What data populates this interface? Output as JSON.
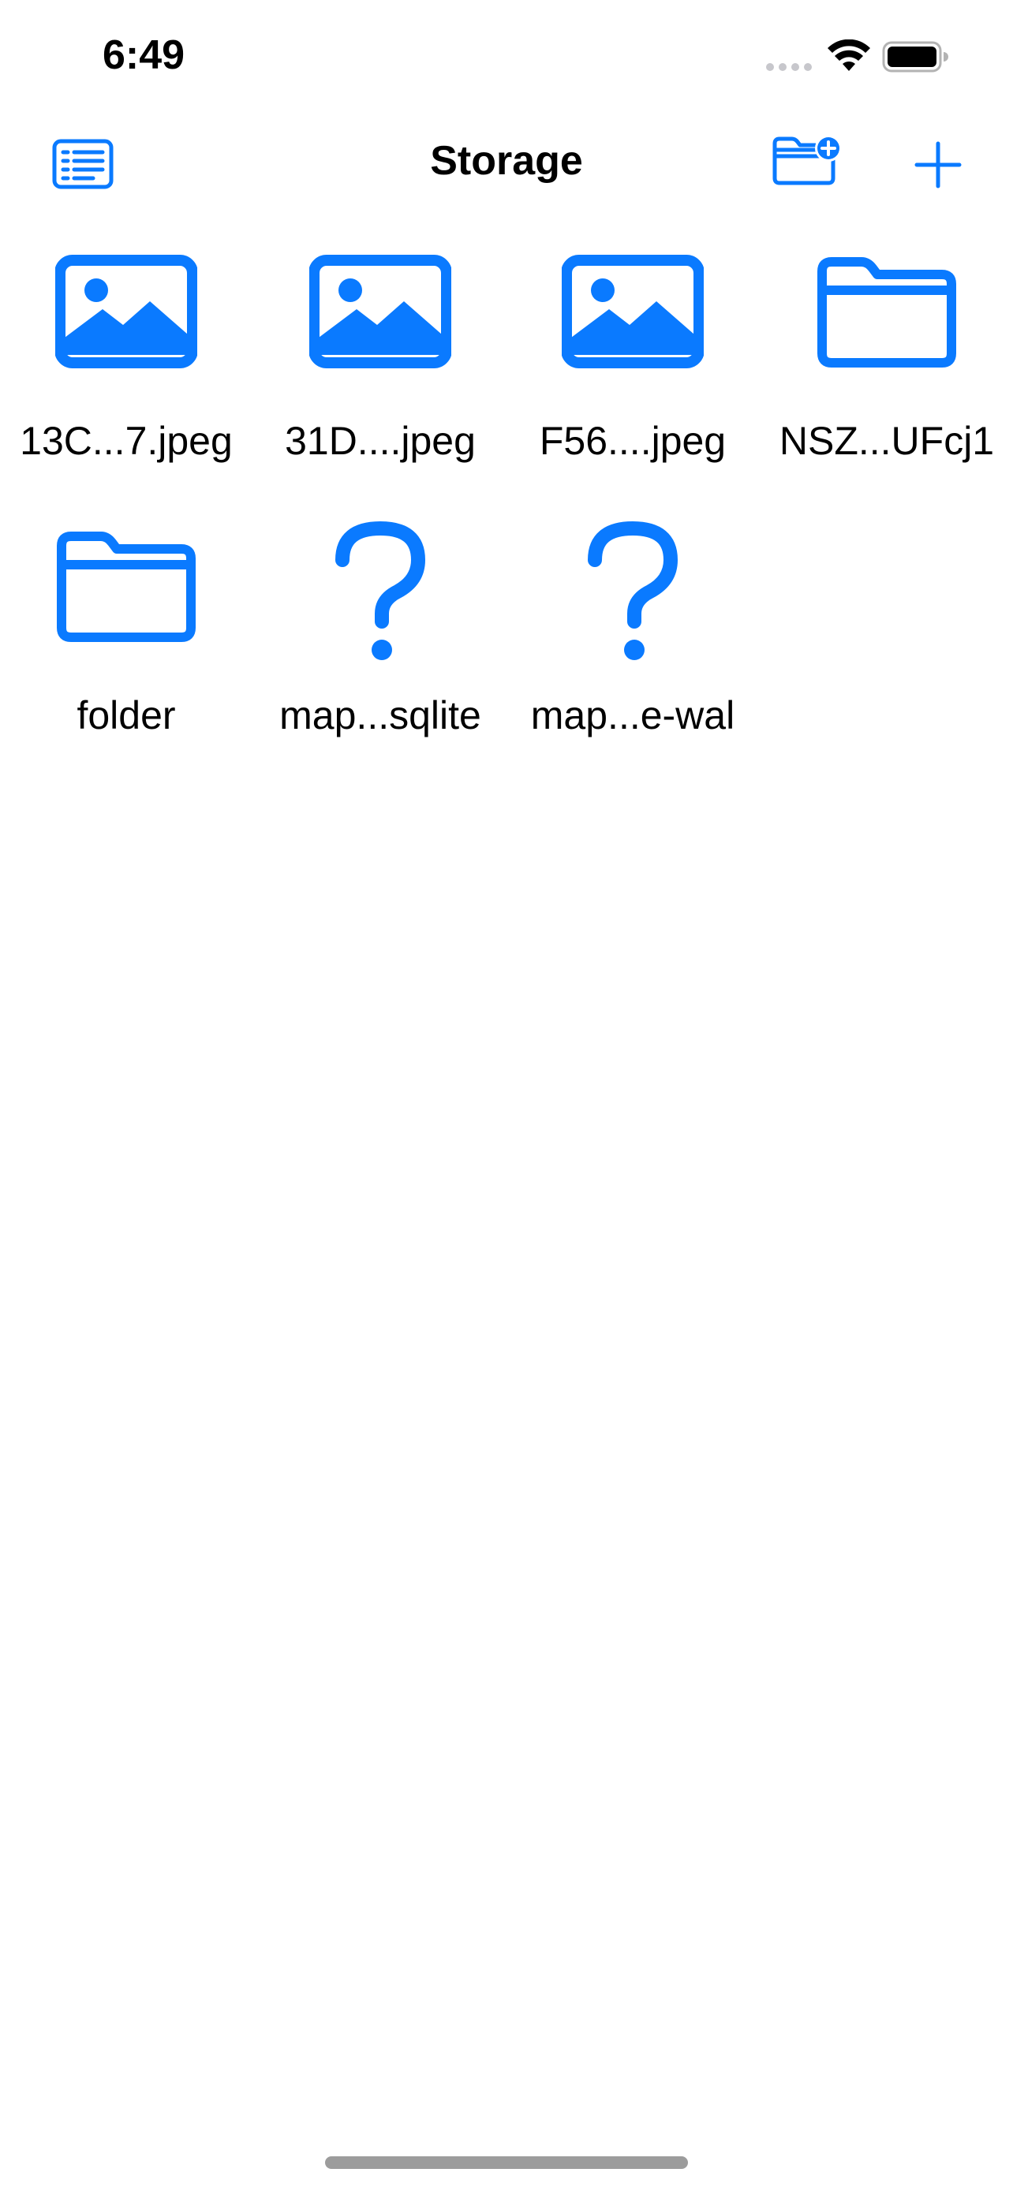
{
  "status_bar": {
    "time": "6:49",
    "signal_icon": "cellular-signal-dots",
    "wifi_icon": "wifi-icon",
    "battery_icon": "battery-full-icon"
  },
  "nav_bar": {
    "title": "Storage",
    "left_button_icon": "sidebar-list-icon",
    "right_buttons": [
      "new-folder-icon",
      "plus-icon"
    ]
  },
  "files": [
    {
      "name": "13C...7.jpeg",
      "kind": "image"
    },
    {
      "name": "31D....jpeg",
      "kind": "image"
    },
    {
      "name": "F56....jpeg",
      "kind": "image"
    },
    {
      "name": "NSZ...UFcj1",
      "kind": "folder"
    },
    {
      "name": "folder",
      "kind": "folder"
    },
    {
      "name": "map...sqlite",
      "kind": "unknown"
    },
    {
      "name": "map...e-wal",
      "kind": "unknown"
    }
  ],
  "colors": {
    "accent": "#0a7aff",
    "text": "#000000",
    "background": "#ffffff",
    "home_indicator": "#9c9c9c"
  }
}
